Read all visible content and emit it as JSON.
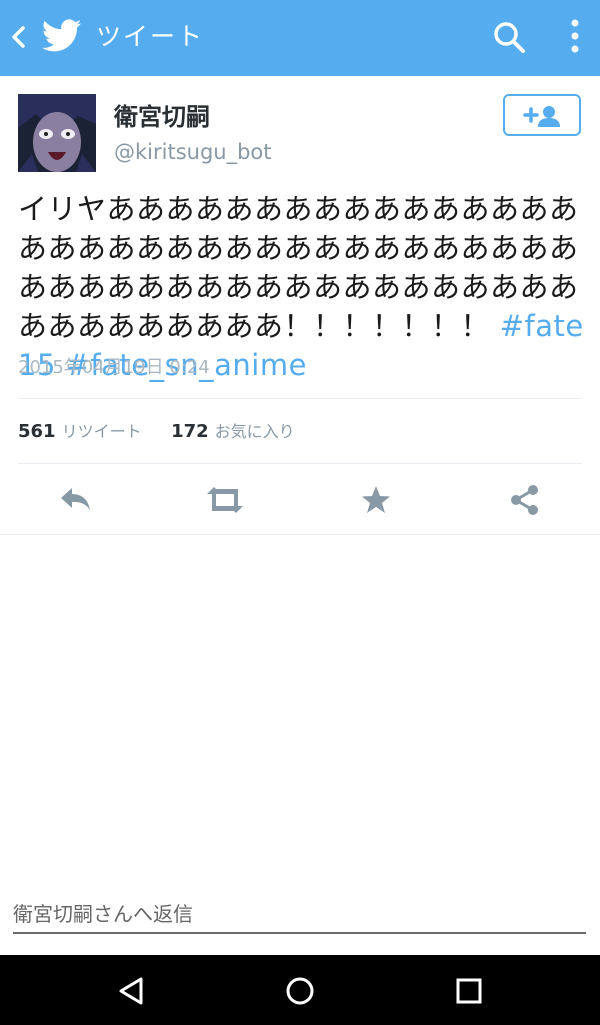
{
  "appbar": {
    "title": "ツイート",
    "color": "#55acee"
  },
  "tweet": {
    "author_name": "衛宮切嗣",
    "author_handle": "@kiritsugu_bot",
    "text": "イリヤあああああああああああああああああああああああああああああああああああああああああああああああああああああああああああああああ！！！！！！！",
    "hashtags": [
      "#fate15",
      "#fate_sn_anime"
    ],
    "timestamp": "2015年04月19日 0:24"
  },
  "stats": {
    "retweet_count": "561",
    "retweet_label": "リツイート",
    "favorite_count": "172",
    "favorite_label": "お気に入り"
  },
  "actions": [
    "reply-icon",
    "retweet-icon",
    "favorite-star-icon",
    "share-icon"
  ],
  "reply": {
    "placeholder": "衛宮切嗣さんへ返信"
  },
  "colors": {
    "accent": "#55acee",
    "secondary_text": "#8899a6",
    "icon_gray": "#8899a6"
  }
}
